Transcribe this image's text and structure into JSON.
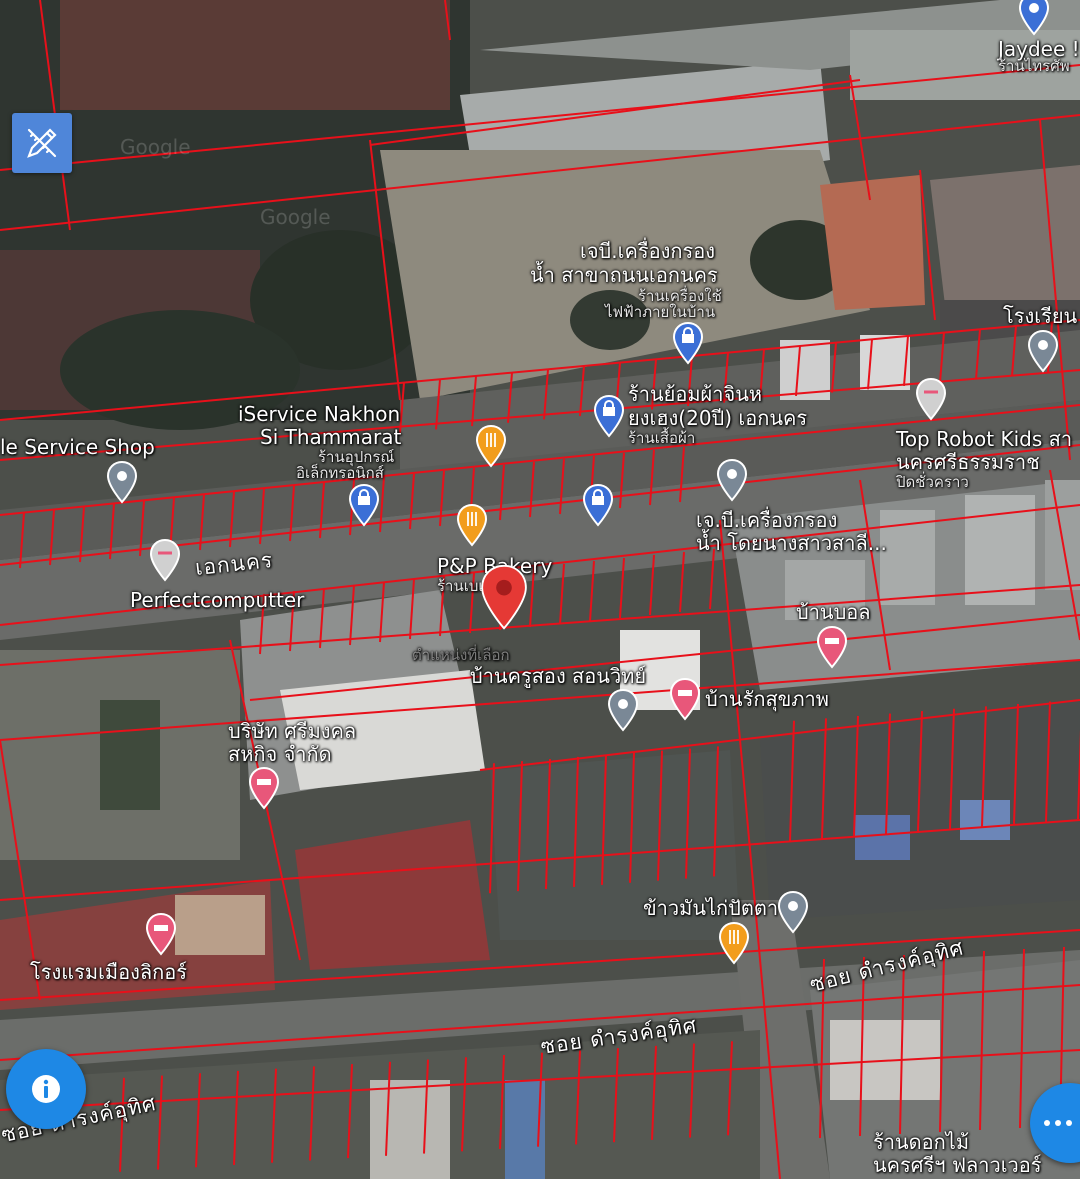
{
  "map": {
    "watermark": "Google",
    "road_labels": {
      "main_road": "เอกนคร",
      "soi_1": "ซอย ดำรงค์อุทิศ",
      "soi_2": "ซอย ดำรงค์อุทิศ",
      "soi_3": "ซอย ดำรงค์อุทิศ"
    },
    "places": {
      "jaydee_name": "Jaydee !",
      "jaydee_sub": "ร้านไทรศัพ",
      "jp_filter_1_name": "เจบี.เครื่องกรอง",
      "jp_filter_1_name2": "น้ำ สาขาถนนเอกนคร",
      "jp_filter_1_sub": "ร้านเครื่องใช้",
      "jp_filter_1_sub2": "ไฟฟ้าภายในบ้าน",
      "school_name": "โรงเรียน",
      "tailor_name": "ร้านย้อมผ้าจินห",
      "tailor_name2": "ยงเฮง(20ปี) เอกนคร",
      "tailor_sub": "ร้านเสื้อผ้า",
      "iservice_name": "iService Nakhon",
      "iservice_name2": "Si Thammarat",
      "iservice_sub": "ร้านอุปกรณ์",
      "iservice_sub2": "อิเล็กทรอนิกส์",
      "service_shop": "le Service Shop",
      "robot_name": "Top Robot Kids สา",
      "robot_name2": "นครศรีธรรมราช",
      "robot_sub": "ปิดชั่วคราว",
      "jp_filter_2_name": "เจ.บี.เครื่องกรอง",
      "jp_filter_2_name2": "น้ำ โดยนางสาวสาลี...",
      "bakery_name": "P&P Bakery",
      "bakery_sub": "ร้านเบเกอรี่",
      "perfect": "Perfectcomputter",
      "ban_bon": "บ้านบอล",
      "selected_faint": "ตำแหน่งที่เลือก",
      "kru_song": "บ้านครูสอง สอนวิทย์",
      "rak_sukkhaphap": "บ้านรักสุขภาพ",
      "company_name": "บริษัท ศรีมงคล",
      "company_name2": "สหกิจ จำกัด",
      "chicken_rice": "ข้าวมันไก่ปัตตานี",
      "hotel": "โรงแรมเมืองลิกอร์",
      "flower_name": "ร้านดอกไม้",
      "flower_name2": "นครศรีฯ ฟลาวเวอร์"
    }
  },
  "controls": {
    "draw_tool_icon": "pencil-ruler-icon",
    "info_icon": "info-icon",
    "more_icon": "more-dots-icon"
  },
  "colors": {
    "parcel_lines": "#e8101a",
    "selected_pin": "#e53935",
    "pin_gray": "#7a8896",
    "pin_blue": "#3b6fd6",
    "pin_orange": "#f29d1c",
    "pin_pink": "#e8577a",
    "button_blue": "#1e88e5"
  }
}
